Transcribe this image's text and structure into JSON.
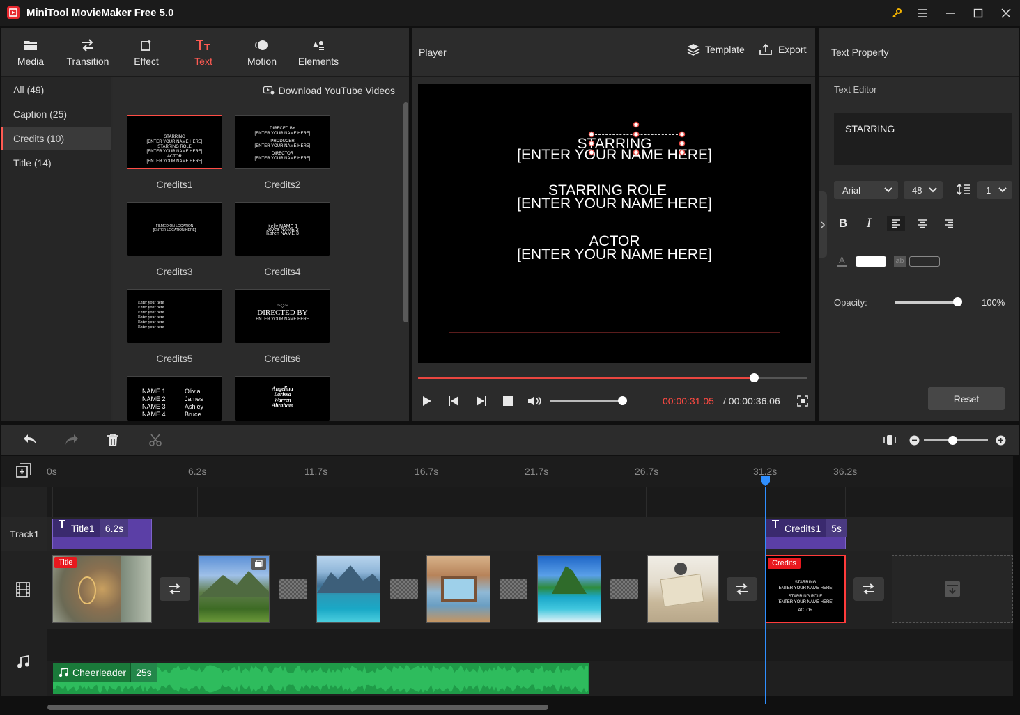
{
  "app": {
    "title": "MiniTool MovieMaker Free 5.0"
  },
  "toolbar": {
    "items": [
      {
        "label": "Media",
        "icon": "folder-icon"
      },
      {
        "label": "Transition",
        "icon": "swap-icon"
      },
      {
        "label": "Effect",
        "icon": "effect-icon"
      },
      {
        "label": "Text",
        "icon": "text-icon",
        "active": true
      },
      {
        "label": "Motion",
        "icon": "motion-icon"
      },
      {
        "label": "Elements",
        "icon": "elements-icon"
      }
    ]
  },
  "categories": [
    {
      "label": "All (49)"
    },
    {
      "label": "Caption (25)"
    },
    {
      "label": "Credits (10)",
      "active": true
    },
    {
      "label": "Title (14)"
    }
  ],
  "gallery": {
    "youtube_link": "Download YouTube Videos",
    "items": [
      {
        "label": "Credits1",
        "lines": [
          "STARRING",
          "[ENTER YOUR NAME HERE]",
          "STARRING ROLE",
          "[ENTER YOUR NAME HERE]",
          "ACTOR",
          "[ENTER YOUR NAME HERE]"
        ]
      },
      {
        "label": "Credits2",
        "lines": [
          "DIRECED BY",
          "[ENTER YOUR NAME HERE]",
          "PRODUCER",
          "[ENTER YOUR NAME HERE]",
          "DIRECTOR",
          "[ENTER YOUR NAME HERE]"
        ]
      },
      {
        "label": "Credits3",
        "lines": [
          "FILMED ON LOCATION",
          "[ENTER LOCATION HERE]"
        ]
      },
      {
        "label": "Credits4",
        "lines": [
          "Kelly NAME 1",
          "Joyce NAME 2",
          "Karen NAME 3"
        ]
      },
      {
        "label": "Credits5",
        "lines": [
          "Enter your here",
          "Enter your here",
          "Enter your here",
          "Enter your here",
          "Enter your here",
          "Enter your here"
        ]
      },
      {
        "label": "Credits6",
        "lines": [
          "DIRECTED BY",
          "ENTER YOUR NAME HERE"
        ]
      },
      {
        "label": "Credits7",
        "names": [
          [
            "NAME 1",
            "Olivia"
          ],
          [
            "NAME 2",
            "James"
          ],
          [
            "NAME 3",
            "Ashley"
          ],
          [
            "NAME 4",
            "Bruce"
          ]
        ]
      },
      {
        "label": "Credits8",
        "lines": [
          "Angelina",
          "Larissa",
          "Warren",
          "Abraham"
        ]
      }
    ]
  },
  "player": {
    "title": "Player",
    "template_label": "Template",
    "export_label": "Export",
    "credits": [
      {
        "role": "STARRING",
        "name": "[ENTER YOUR NAME HERE]"
      },
      {
        "role": "STARRING ROLE",
        "name": "[ENTER YOUR NAME HERE]"
      },
      {
        "role": "ACTOR",
        "name": "[ENTER YOUR NAME HERE]"
      }
    ],
    "progress": 0.863,
    "volume": 0.93,
    "time_current": "00:00:31.05",
    "time_total": "/ 00:00:36.06"
  },
  "text_property": {
    "title": "Text Property",
    "editor_label": "Text Editor",
    "editor_text": "STARRING",
    "font": "Arial",
    "size": "48",
    "line_spacing": "1",
    "opacity_label": "Opacity:",
    "opacity_value": "100%",
    "reset_label": "Reset",
    "text_color": "#ffffff"
  },
  "timeline": {
    "ticks": [
      "0s",
      "6.2s",
      "11.7s",
      "16.7s",
      "21.7s",
      "26.7s",
      "31.2s",
      "36.2s"
    ],
    "track1_label": "Track1",
    "text_clips": [
      {
        "name": "Title1",
        "duration": "6.2s"
      },
      {
        "name": "Credits1",
        "duration": "5s"
      }
    ],
    "video_clips": [
      {
        "badge": "Title"
      },
      {
        "badge": ""
      },
      {
        "badge": ""
      },
      {
        "badge": ""
      },
      {
        "badge": ""
      },
      {
        "badge": ""
      },
      {
        "badge": "Credits"
      }
    ],
    "credits_clip_lines": [
      "STARRING",
      "[ENTER YOUR NAME HERE]",
      "STARRING ROLE",
      "[ENTER YOUR NAME HERE]",
      "ACTOR"
    ],
    "audio_clip": {
      "name": "Cheerleader",
      "duration": "25s"
    }
  },
  "colors": {
    "accent": "#ff5a52",
    "playhead": "#2f8fff",
    "text_clip": "#5b3fa6",
    "audio_clip": "#1f9b48",
    "badge": "#e8181e"
  }
}
